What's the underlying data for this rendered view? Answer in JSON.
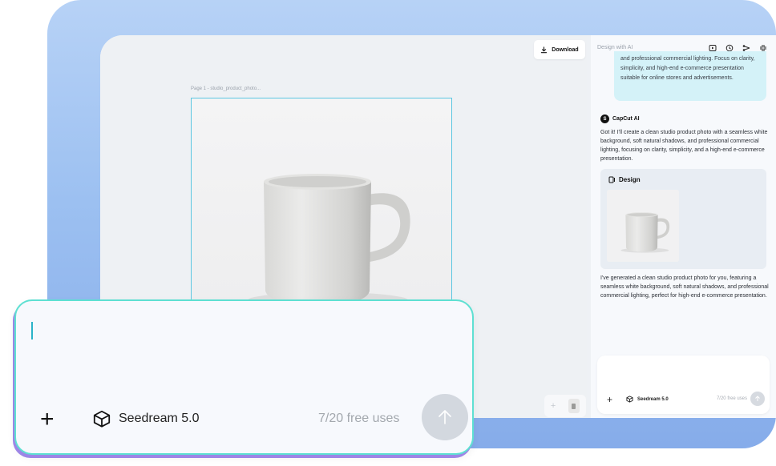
{
  "toolbar": {
    "download_label": "Download"
  },
  "canvas": {
    "page_label": "Page 1 -   studio_product_photo..."
  },
  "panel": {
    "title": "Design with AI",
    "user_message": "and professional commercial lighting. Focus on clarity, simplicity, and high-end e-commerce presentation suitable for online stores and advertisements.",
    "ai_name": "CapCut AI",
    "ai_logo": "S",
    "ai_reply_1": "Got it! I'll create a clean studio product photo with a seamless white background, soft natural shadows, and professional commercial lighting, focusing on clarity, simplicity, and a high-end e-commerce presentation.",
    "design_card_title": "Design",
    "ai_reply_2": "I've generated a clean studio product photo for you, featuring a seamless white background, soft natural shadows, and professional commercial lighting, perfect for high-end e-commerce presentation.",
    "icons": [
      "play-square-icon",
      "history-icon",
      "share-icon",
      "collapse-icon"
    ]
  },
  "composer": {
    "model_name": "Seedream 5.0",
    "free_uses": "7/20 free uses",
    "plus_glyph": "+"
  },
  "mini_composer": {
    "model_name": "Seedream 5.0",
    "free_uses": "7/20 free uses",
    "plus_glyph": "+"
  },
  "zoom_controls": {
    "plus_glyph": "+"
  },
  "colors": {
    "accent": "#5cc7e2",
    "user_bubble": "#d4f2f8",
    "composer_border": "#5ee0d2"
  }
}
